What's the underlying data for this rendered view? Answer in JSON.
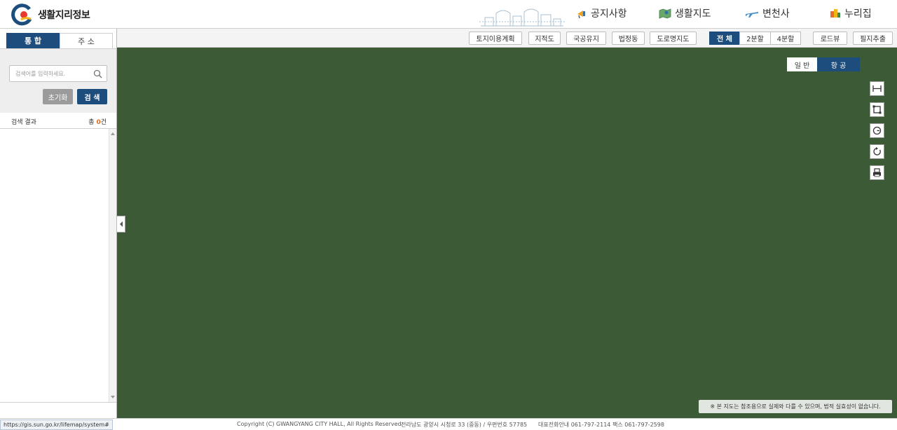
{
  "header": {
    "logo_text": "생활지리정보",
    "nav": [
      {
        "label": "공지사항",
        "icon": "megaphone-icon"
      },
      {
        "label": "생활지도",
        "icon": "map-icon"
      },
      {
        "label": "변천사",
        "icon": "airplane-icon"
      },
      {
        "label": "누리집",
        "icon": "home-blocks-icon"
      }
    ]
  },
  "toolbar": {
    "layers": [
      "토지이용계획",
      "지적도",
      "국공유지",
      "법정동",
      "도로명지도"
    ],
    "split": [
      "전 체",
      "2분할",
      "4분할"
    ],
    "split_active": "전 체",
    "tools": [
      "로드뷰",
      "필지추출"
    ]
  },
  "sidebar": {
    "tabs": [
      "통 합",
      "주 소"
    ],
    "active_tab": "통 합",
    "search": {
      "placeholder": "검색어를 입력하세요.",
      "value": "",
      "reset_label": "초기화",
      "search_label": "검 색"
    },
    "results": {
      "label": "검색 결과",
      "count_prefix": "총 ",
      "count": "0",
      "count_suffix": "건"
    }
  },
  "map": {
    "types": [
      "일 반",
      "항 공"
    ],
    "active_type": "항 공",
    "tools": [
      "distance-icon",
      "area-icon",
      "radius-icon",
      "reset-icon",
      "print-icon"
    ],
    "disclaimer": "※ 본 지도는 참조용으로 실제와 다를 수 있으며, 법적 실효성이 없습니다."
  },
  "footer": {
    "status_url": "https://gis.sun.go.kr/lifemap/system#",
    "copyright": "Copyright (C) GWANGYANG CITY HALL, All Rights Reserved.",
    "address": "전라남도 광양시 시청로 33 (중동) / 우편번호 57785",
    "phone": "대표전화안내 061-797-2114",
    "fax": "팩스 061-797-2598"
  },
  "colors": {
    "brand_navy": "#1c4d7c",
    "accent_orange": "#e06a18"
  }
}
